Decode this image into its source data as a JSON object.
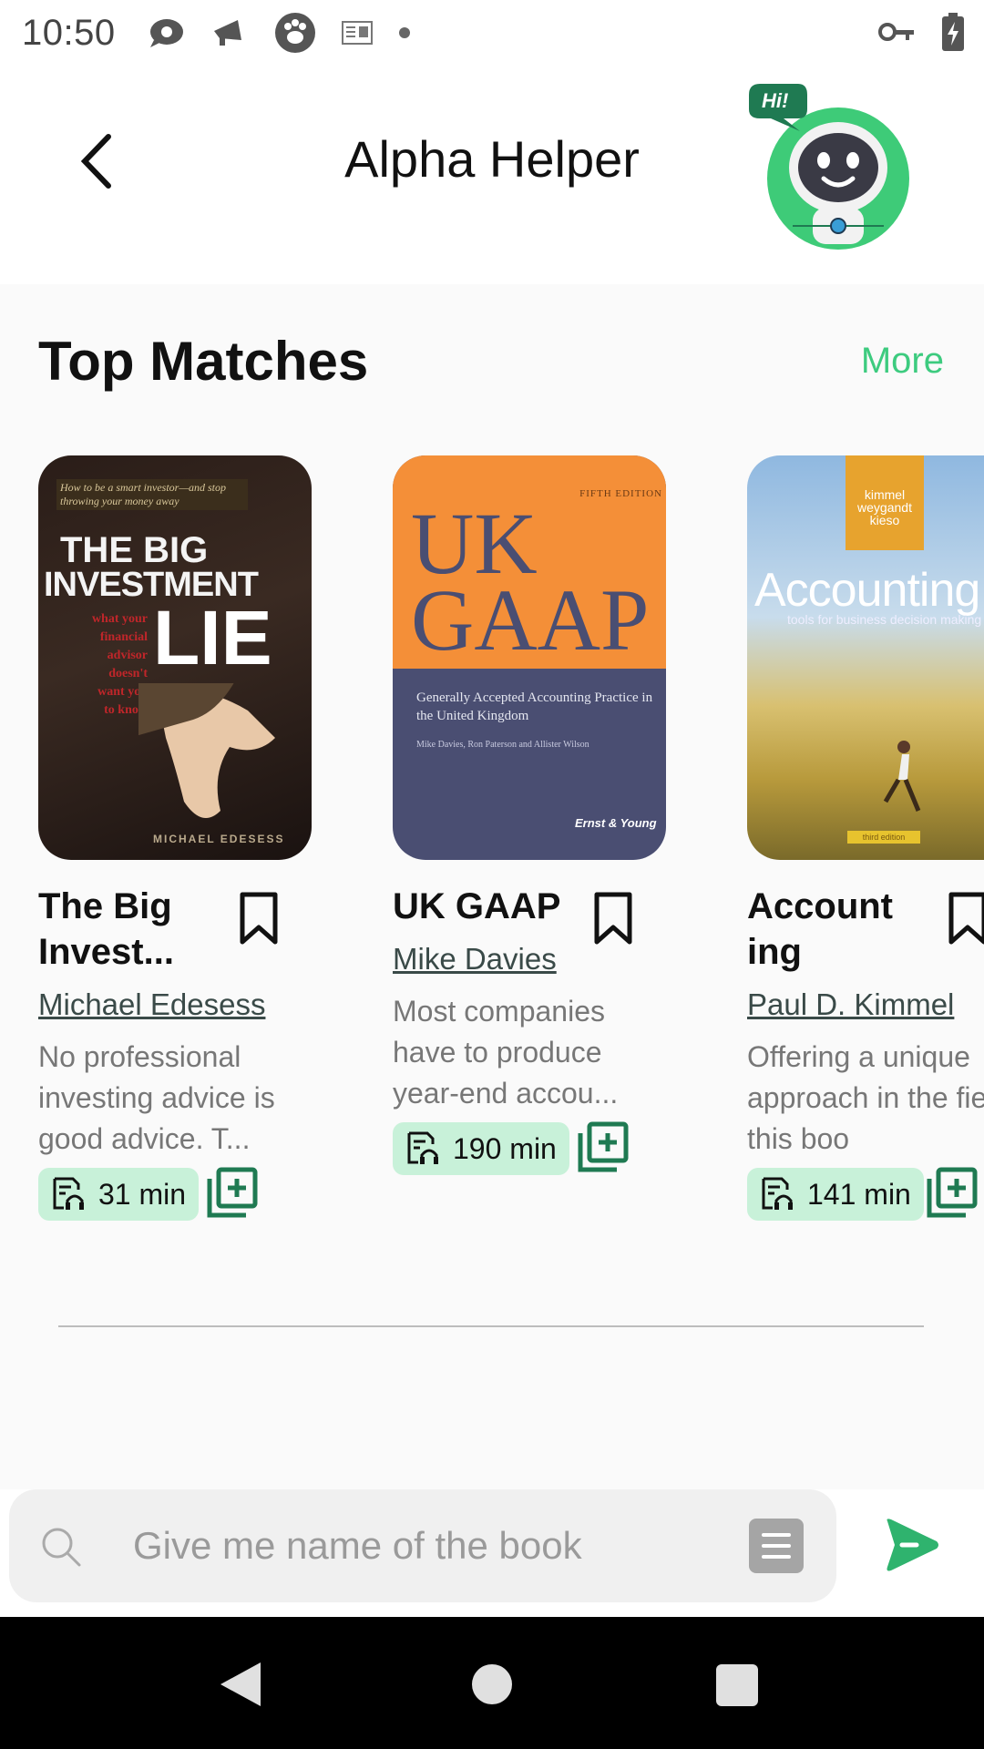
{
  "status_bar": {
    "time": "10:50",
    "icons": [
      "message-icon",
      "megaphone-icon",
      "paw-icon",
      "reader-icon",
      "dot-icon",
      "vpn-key-icon",
      "battery-charging-icon"
    ]
  },
  "header": {
    "title": "Alpha Helper",
    "back_icon": "chevron-left-icon",
    "bot_bubble": "Hi!"
  },
  "section": {
    "title": "Top Matches",
    "more_label": "More"
  },
  "books": [
    {
      "title_lines": [
        "The Big",
        "Invest..."
      ],
      "author": "Michael Edesess",
      "description": "No professional investing advice is good advice. T...",
      "duration": "31 min",
      "cover": {
        "tagline": "How to be a smart investor—and stop throwing your money away",
        "line1": "THE BIG",
        "line2": "INVESTMENT",
        "line3": "LIE",
        "sub": [
          "what your",
          "financial",
          "advisor",
          "doesn't",
          "want you",
          "to know"
        ],
        "author": "MICHAEL EDESESS"
      }
    },
    {
      "title_lines": [
        "UK GAAP"
      ],
      "author": "Mike Davies",
      "description": "Most companies have to produce year-end accou...",
      "duration": "190 min",
      "cover": {
        "edition": "FIFTH EDITION",
        "line1": "UK",
        "line2": "GAAP",
        "subtitle": "Generally Accepted Accounting Practice in the United Kingdom",
        "authors": "Mike Davies, Ron Paterson and Allister Wilson",
        "publisher": "Ernst & Young"
      }
    },
    {
      "title_lines": [
        "Account",
        "ing"
      ],
      "author": "Paul D. Kimmel",
      "description": "Offering a unique approach in the field, this boo",
      "duration": "141 min",
      "cover": {
        "authors_box": [
          "kimmel",
          "weygandt",
          "kieso"
        ],
        "line1": "Accounting",
        "subtitle": "tools for business decision making",
        "edition": "third edition"
      }
    }
  ],
  "composer": {
    "placeholder": "Give me name of the book"
  },
  "colors": {
    "accent": "#3dcb7f",
    "chip": "#c8f1d9",
    "icon_green": "#1f7a52"
  }
}
